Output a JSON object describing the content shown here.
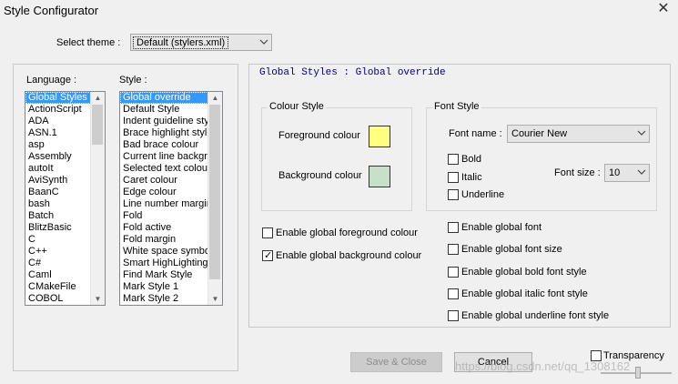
{
  "window": {
    "title": "Style Configurator",
    "close_glyph": "✕"
  },
  "theme": {
    "label": "Select theme :",
    "selected": "Default (stylers.xml)"
  },
  "language": {
    "label": "Language :",
    "items": [
      "Global Styles",
      "ActionScript",
      "ADA",
      "ASN.1",
      "asp",
      "Assembly",
      "autoIt",
      "AviSynth",
      "BaanC",
      "bash",
      "Batch",
      "BlitzBasic",
      "C",
      "C++",
      "C#",
      "Caml",
      "CMakeFile",
      "COBOL"
    ],
    "selected_index": 0
  },
  "style": {
    "label": "Style :",
    "items": [
      "Global override",
      "Default Style",
      "Indent guideline style",
      "Brace highlight style",
      "Bad brace colour",
      "Current line background colour",
      "Selected text colour",
      "Caret colour",
      "Edge colour",
      "Line number margin",
      "Fold",
      "Fold active",
      "Fold margin",
      "White space symbol",
      "Smart HighLighting",
      "Find Mark Style",
      "Mark Style 1",
      "Mark Style 2"
    ],
    "selected_index": 0
  },
  "detail": {
    "header": "Global Styles : Global override",
    "colour_style": {
      "title": "Colour Style",
      "foreground_label": "Foreground colour",
      "background_label": "Background colour",
      "foreground_color": "#ffff80",
      "background_color": "#c7e0c8"
    },
    "font_style": {
      "title": "Font Style",
      "font_name_label": "Font name :",
      "font_name": "Courier New",
      "font_size_label": "Font size :",
      "font_size": "10",
      "bold_label": "Bold",
      "italic_label": "Italic",
      "underline_label": "Underline",
      "bold": false,
      "italic": false,
      "underline": false
    },
    "enable": {
      "global_fg_label": "Enable global foreground colour",
      "global_fg": false,
      "global_bg_label": "Enable global background colour",
      "global_bg": true,
      "global_font_label": "Enable global font",
      "global_font": false,
      "global_font_size_label": "Enable global font size",
      "global_font_size": false,
      "global_bold_label": "Enable global bold font style",
      "global_bold": false,
      "global_italic_label": "Enable global italic font style",
      "global_italic": false,
      "global_underline_label": "Enable global underline font style",
      "global_underline": false
    }
  },
  "buttons": {
    "save_close": "Save & Close",
    "cancel": "Cancel"
  },
  "transparency": {
    "label": "Transparency",
    "enabled": false
  },
  "watermark": "https://blog.csdn.net/qq_1308162"
}
